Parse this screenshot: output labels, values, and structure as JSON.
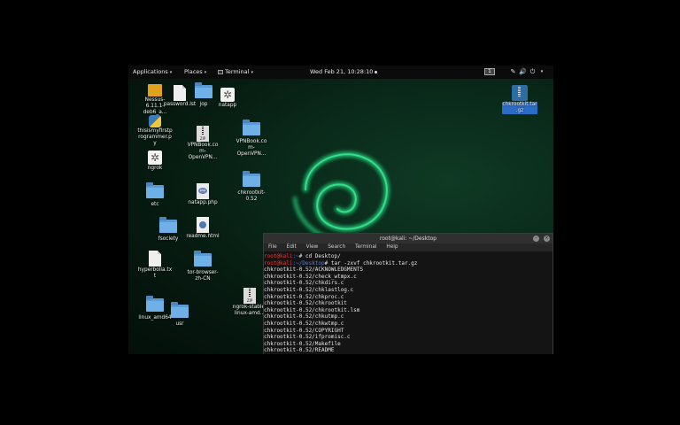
{
  "topbar": {
    "applications": "Applications",
    "places": "Places",
    "terminal": "Terminal",
    "clock": "Wed Feb 21, 10:28:10",
    "workspace": "1"
  },
  "desktop_icons": [
    {
      "label": "Nessus-6.11.1-deb6_a...",
      "type": "nessus"
    },
    {
      "label": "password.lst",
      "type": "doc"
    },
    {
      "label": "jop",
      "type": "folder"
    },
    {
      "label": "natapp",
      "type": "gear"
    },
    {
      "label": "thisismyfirstprogrammer.py",
      "type": "python"
    },
    {
      "label": "ngrok",
      "type": "gear"
    },
    {
      "label": "VPNBook.com-OpenVPN...",
      "type": "zip"
    },
    {
      "label": "VPNBook.com-OpenVPN...",
      "type": "folder"
    },
    {
      "label": "etc",
      "type": "folder"
    },
    {
      "label": "natapp.php",
      "type": "php"
    },
    {
      "label": "chkrootkit-0.52",
      "type": "folder"
    },
    {
      "label": "fsociety",
      "type": "folder"
    },
    {
      "label": "readme.html",
      "type": "html"
    },
    {
      "label": "hyperbolia.txt",
      "type": "doc"
    },
    {
      "label": "tor-browser-zh-CN",
      "type": "folder"
    },
    {
      "label": "ngrok-stable-linux-amd...",
      "type": "zip"
    },
    {
      "label": "linux_amd64",
      "type": "folder"
    },
    {
      "label": "usr",
      "type": "folder"
    },
    {
      "label": "chkrootkit.tar.gz",
      "type": "tgz"
    }
  ],
  "terminal": {
    "title": "root@kali: ~/Desktop",
    "menu": [
      "File",
      "Edit",
      "View",
      "Search",
      "Terminal",
      "Help"
    ],
    "prompt1_user": "root@kali",
    "prompt1_path": ":~",
    "prompt1_cmd": "# cd Desktop/",
    "prompt2_user": "root@kali",
    "prompt2_path": ":~/Desktop",
    "prompt2_cmd": "# tar -zxvf chkrootkit.tar.gz",
    "output": [
      "chkrootkit-0.52/ACKNOWLEDGMENTS",
      "chkrootkit-0.52/check_wtmpx.c",
      "chkrootkit-0.52/chkdirs.c",
      "chkrootkit-0.52/chklastlog.c",
      "chkrootkit-0.52/chkproc.c",
      "chkrootkit-0.52/chkrootkit",
      "chkrootkit-0.52/chkrootkit.lsm",
      "chkrootkit-0.52/chkutmp.c",
      "chkrootkit-0.52/chkwtmp.c",
      "chkrootkit-0.52/COPYRIGHT",
      "chkrootkit-0.52/ifpromisc.c",
      "chkrootkit-0.52/Makefile",
      "chkrootkit-0.52/README"
    ]
  },
  "colors": {
    "prompt_user": "#e23b3b",
    "prompt_path": "#4d7fe0",
    "selection": "#2b6cc4"
  }
}
